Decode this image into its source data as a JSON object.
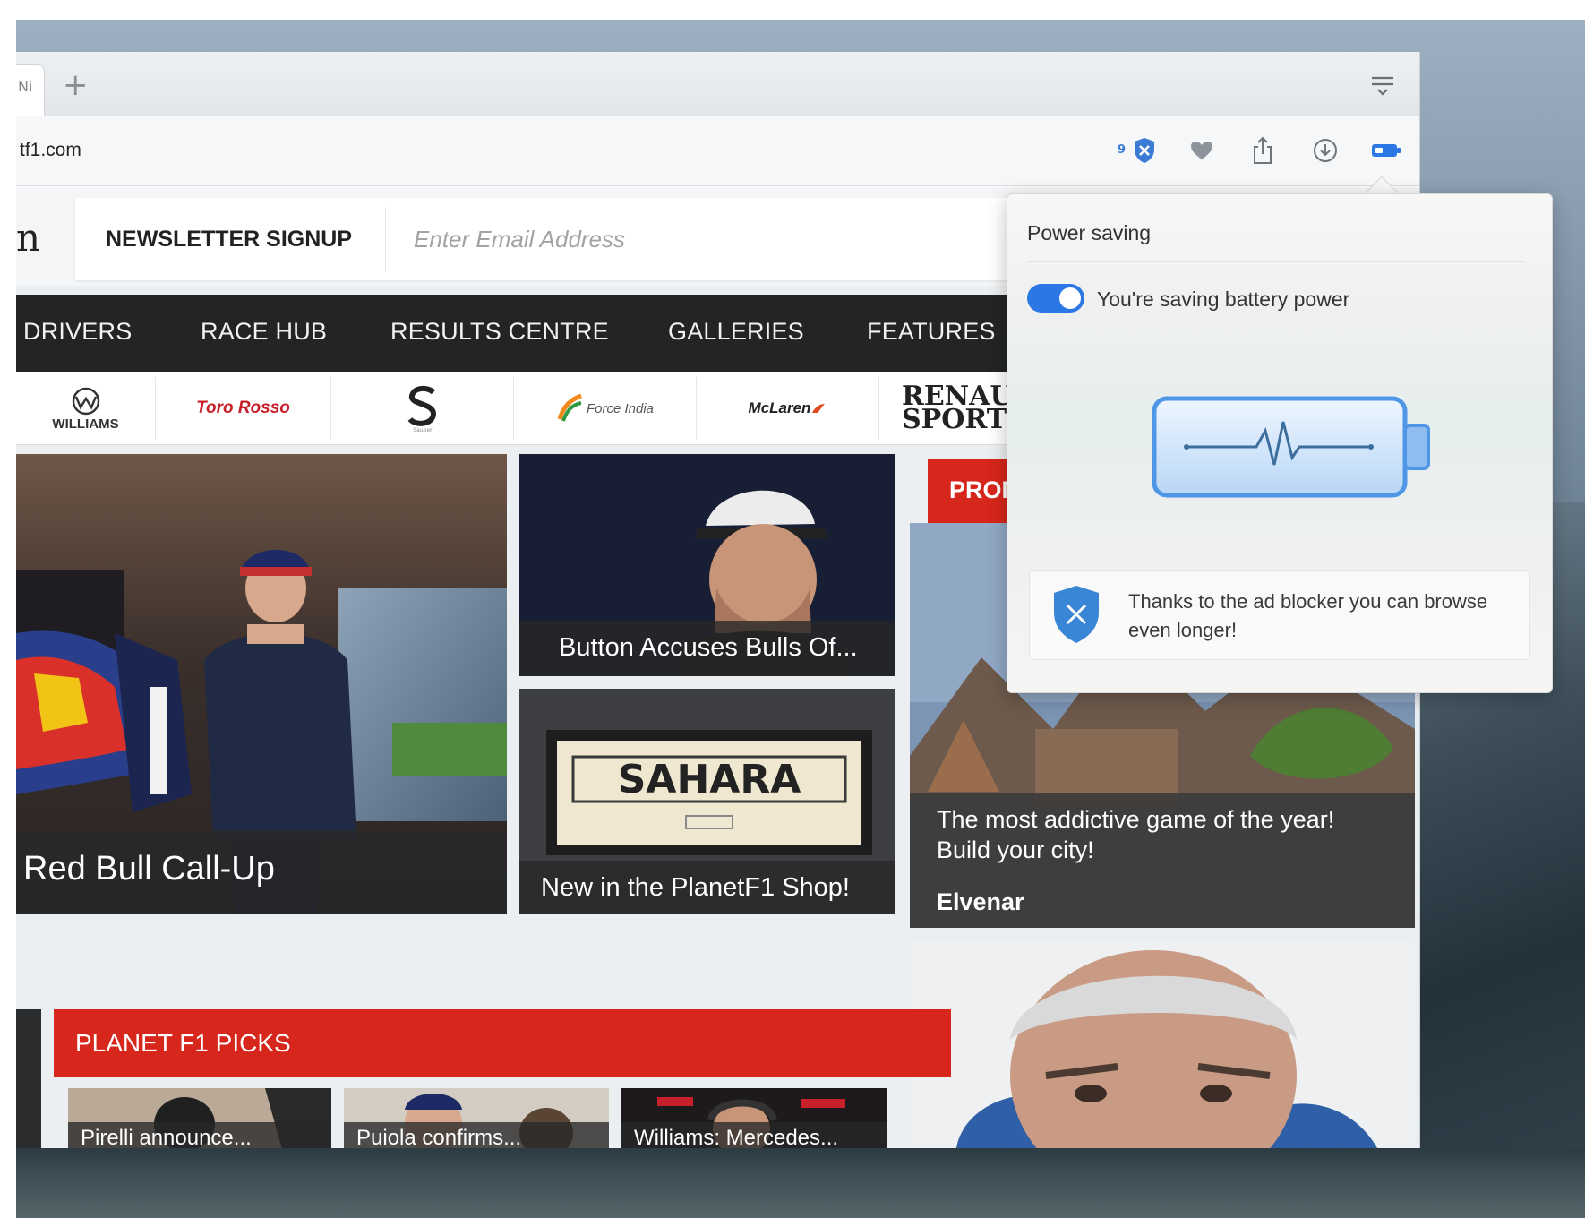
{
  "browser": {
    "tab_partial_label": "Ni",
    "url": "tf1.com",
    "adblock_count": "9"
  },
  "page": {
    "logo_partial": "n",
    "newsletter": {
      "label": "NEWSLETTER SIGNUP",
      "placeholder": "Enter Email Address"
    },
    "nav": [
      "DRIVERS",
      "RACE HUB",
      "RESULTS CENTRE",
      "GALLERIES",
      "FEATURES"
    ],
    "teams": [
      "WILLIAMS",
      "Toro Rosso",
      "Sauber",
      "Force India",
      "McLaren",
      "RENAULT SPORT"
    ],
    "stories": {
      "main_caption": "Red Bull Call-Up",
      "button_caption": "Button Accuses Bulls Of...",
      "shop_caption": "New in the PlanetF1 Shop!",
      "shop_sign": "SAHARA",
      "promo_label": "PROMO",
      "promo_caption_1": "The most addictive game of the year!",
      "promo_caption_2": "Build your city!",
      "promo_source": "Elvenar"
    },
    "picks": {
      "title": "PLANET F1 PICKS",
      "items": [
        "Pirelli announce...",
        "Puiola confirms...",
        "Williams: Mercedes..."
      ]
    }
  },
  "popup": {
    "title": "Power saving",
    "toggle_label": "You're saving battery power",
    "toggle_on": true,
    "info_text": "Thanks to the ad blocker you can browse even longer!"
  },
  "colors": {
    "accent_red": "#d7261b",
    "toggle_blue": "#2b78e4",
    "nav_dark": "#222426"
  }
}
